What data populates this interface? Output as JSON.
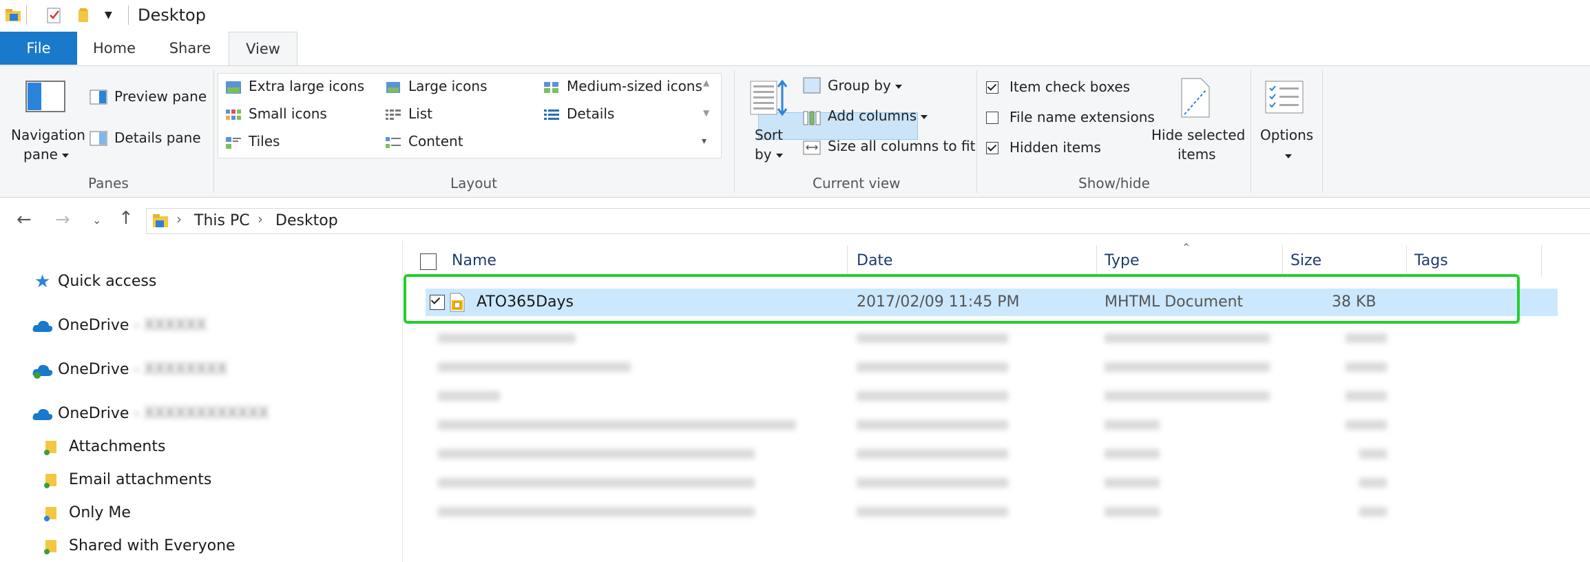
{
  "window": {
    "title": "Desktop"
  },
  "tabs": [
    {
      "label": "File"
    },
    {
      "label": "Home"
    },
    {
      "label": "Share"
    },
    {
      "label": "View"
    }
  ],
  "ribbon": {
    "panes": {
      "navigation_pane_line1": "Navigation",
      "navigation_pane_line2": "pane",
      "preview_pane": "Preview pane",
      "details_pane": "Details pane",
      "group_label": "Panes"
    },
    "layout": {
      "extra_large_icons": "Extra large icons",
      "large_icons": "Large icons",
      "medium_icons": "Medium-sized icons",
      "small_icons": "Small icons",
      "list": "List",
      "details": "Details",
      "tiles": "Tiles",
      "content": "Content",
      "group_label": "Layout",
      "selected": "Details"
    },
    "current_view": {
      "sort_line1": "Sort",
      "sort_line2": "by",
      "group_by": "Group by",
      "add_columns": "Add columns",
      "size_columns": "Size all columns to fit",
      "group_label": "Current view"
    },
    "show_hide": {
      "item_check_boxes": {
        "label": "Item check boxes",
        "checked": true
      },
      "file_name_extensions": {
        "label": "File name extensions",
        "checked": false
      },
      "hidden_items": {
        "label": "Hidden items",
        "checked": true
      },
      "hide_selected_line1": "Hide selected",
      "hide_selected_line2": "items",
      "group_label": "Show/hide"
    },
    "options": {
      "label": "Options"
    }
  },
  "address": {
    "breadcrumbs": [
      "This PC",
      "Desktop"
    ]
  },
  "nav": {
    "quick_access": "Quick access",
    "onedrive_1": "OneDrive",
    "onedrive_2": "OneDrive",
    "onedrive_3": "OneDrive",
    "sub_items": [
      "Attachments",
      "Email attachments",
      "Only Me",
      "Shared with Everyone"
    ]
  },
  "file_list": {
    "columns": {
      "name": "Name",
      "date": "Date",
      "type": "Type",
      "size": "Size",
      "tags": "Tags"
    },
    "selected_row": {
      "name": "ATO365Days",
      "date": "2017/02/09 11:45 PM",
      "type": "MHTML Document",
      "size": "38 KB",
      "checked": true
    }
  },
  "colors": {
    "accent": "#1979ca",
    "selection": "#cce8ff",
    "highlight_frame": "#22d02a"
  },
  "icons": {
    "quick_access": "star-icon",
    "onedrive": "cloud-icon",
    "folder": "folder-icon",
    "file": "mhtml-file-icon"
  }
}
